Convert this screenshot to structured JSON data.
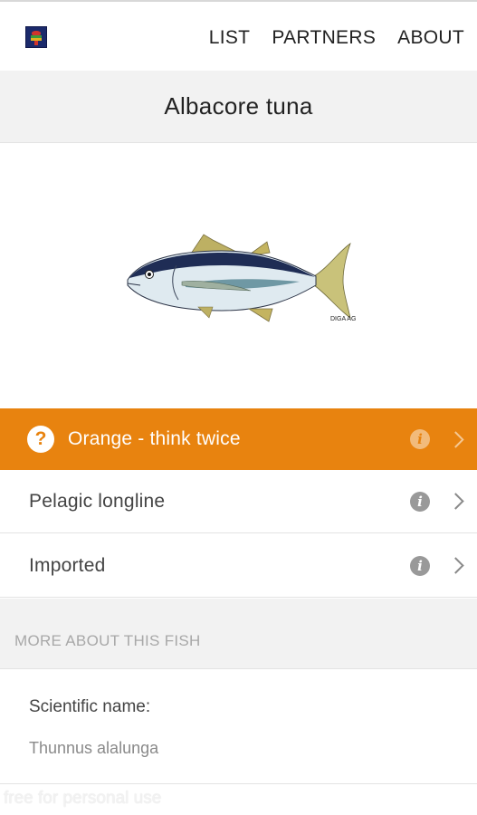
{
  "header": {
    "logo_icon": "seafood-guide-logo-icon",
    "nav": [
      {
        "label": "LIST"
      },
      {
        "label": "PARTNERS"
      },
      {
        "label": "ABOUT"
      }
    ]
  },
  "fish": {
    "name": "Albacore tuna",
    "image_icon": "albacore-tuna-illustration",
    "image_credit": "DIGA AG"
  },
  "rating": {
    "label": "Orange - think twice",
    "status_icon": "question-circle-icon",
    "color": "#e8830f"
  },
  "attributes": [
    {
      "label": "Pelagic longline",
      "icon": "info-icon"
    },
    {
      "label": "Imported",
      "icon": "info-icon"
    }
  ],
  "more_section": {
    "heading": "MORE ABOUT THIS FISH",
    "scientific_label": "Scientific name:",
    "scientific_value": "Thunnus alalunga"
  },
  "watermark": "free for personal use",
  "colors": {
    "accent": "#e8830f",
    "section_bg": "#f2f2f2"
  }
}
